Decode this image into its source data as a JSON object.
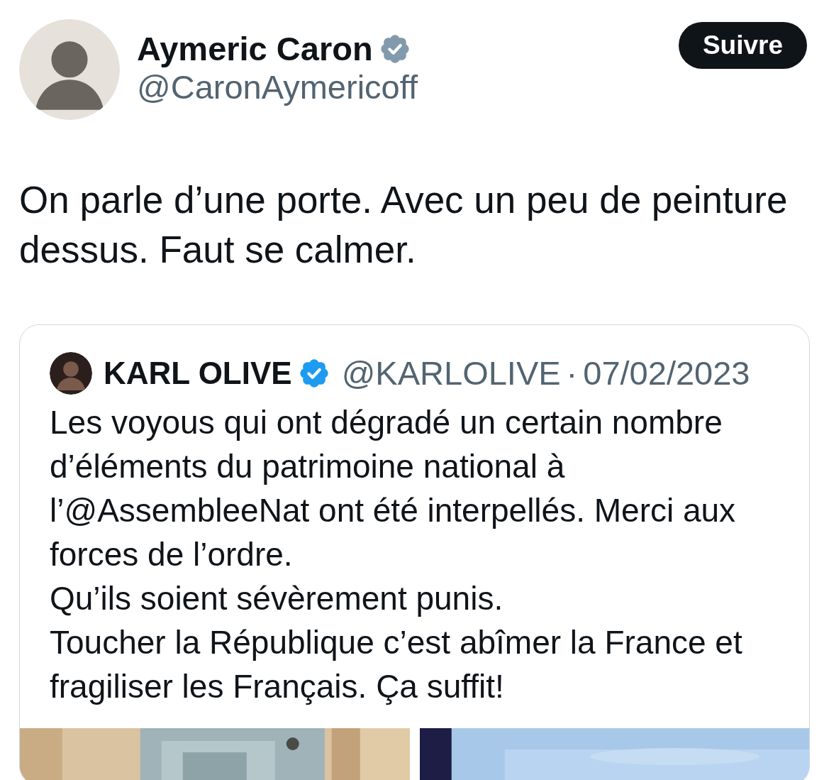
{
  "author": {
    "name": "Aymeric Caron",
    "handle": "@CaronAymericoff",
    "verified_badge": {
      "color": "#829aab"
    }
  },
  "follow_button": {
    "label": "Suivre"
  },
  "text": "On parle d’une porte. Avec un peu de peinture dessus. Faut se calmer.",
  "quoted": {
    "name": "KARL OLIVE",
    "verified_badge": {
      "color": "#1d9bf0"
    },
    "handle": "@KARLOLIVE",
    "separator": "·",
    "date": "07/02/2023",
    "paragraphs": [
      "Les voyous qui ont dégradé un certain nombre d’éléments du patrimoine national à l’@AssembleeNat ont été interpellés. Merci aux forces de l’ordre.",
      "Qu’ils soient sévèrement punis.",
      "Toucher la République c’est abîmer la France et fragiliser les Français. Ça suffit!"
    ]
  }
}
